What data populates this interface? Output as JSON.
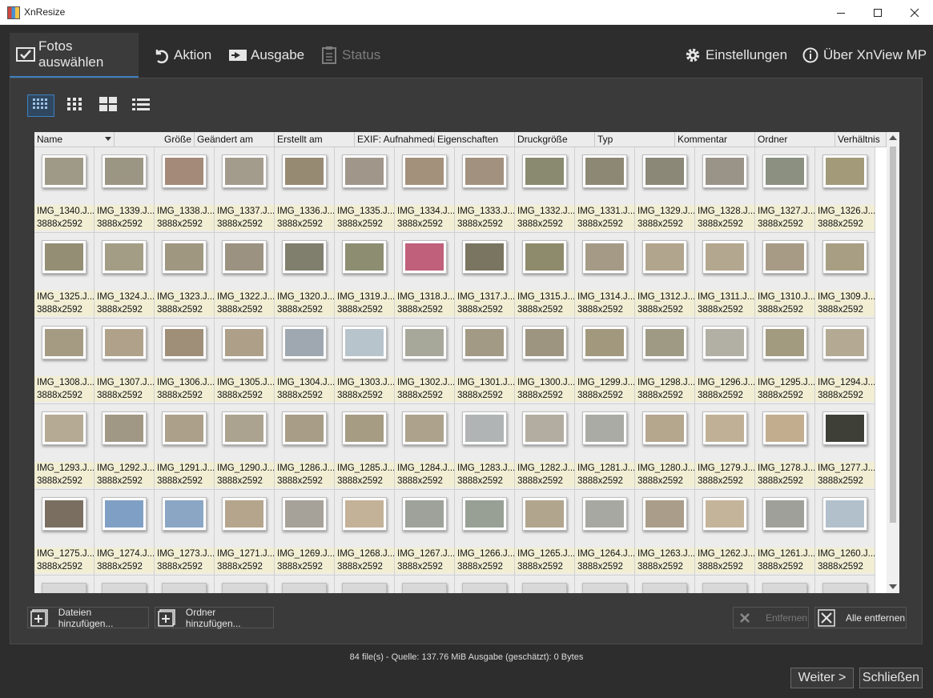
{
  "window": {
    "title": "XnResize"
  },
  "tabs": [
    {
      "label": "Fotos auswählen"
    },
    {
      "label": "Aktion"
    },
    {
      "label": "Ausgabe"
    },
    {
      "label": "Status"
    }
  ],
  "right_tabs": [
    {
      "label": "Einstellungen"
    },
    {
      "label": "Über XnView MP"
    }
  ],
  "columns": [
    "Name",
    "Größe",
    "Geändert am",
    "Erstellt am",
    "EXIF: Aufnahmedatum",
    "Eigenschaften",
    "Druckgröße",
    "Typ",
    "Kommentar",
    "Ordner",
    "Verhältnis"
  ],
  "files": [
    {
      "name": "IMG_1340.J...",
      "dims": "3888x2592",
      "thumb": "#9f9a88"
    },
    {
      "name": "IMG_1339.J...",
      "dims": "3888x2592",
      "thumb": "#9b9583"
    },
    {
      "name": "IMG_1338.J...",
      "dims": "3888x2592",
      "thumb": "#a48a78"
    },
    {
      "name": "IMG_1337.J...",
      "dims": "3888x2592",
      "thumb": "#a39b8c"
    },
    {
      "name": "IMG_1336.J...",
      "dims": "3888x2592",
      "thumb": "#978a73"
    },
    {
      "name": "IMG_1335.J...",
      "dims": "3888x2592",
      "thumb": "#a0968a"
    },
    {
      "name": "IMG_1334.J...",
      "dims": "3888x2592",
      "thumb": "#a4917c"
    },
    {
      "name": "IMG_1333.J...",
      "dims": "3888x2592",
      "thumb": "#a2917f"
    },
    {
      "name": "IMG_1332.J...",
      "dims": "3888x2592",
      "thumb": "#8a8a70"
    },
    {
      "name": "IMG_1331.J...",
      "dims": "3888x2592",
      "thumb": "#8d8873"
    },
    {
      "name": "IMG_1329.J...",
      "dims": "3888x2592",
      "thumb": "#8c8878"
    },
    {
      "name": "IMG_1328.J...",
      "dims": "3888x2592",
      "thumb": "#9a9388"
    },
    {
      "name": "IMG_1327.J...",
      "dims": "3888x2592",
      "thumb": "#8b9081"
    },
    {
      "name": "IMG_1326.J...",
      "dims": "3888x2592",
      "thumb": "#a39a7a"
    },
    {
      "name": "IMG_1325.J...",
      "dims": "3888x2592",
      "thumb": "#948e75"
    },
    {
      "name": "IMG_1324.J...",
      "dims": "3888x2592",
      "thumb": "#a39d85"
    },
    {
      "name": "IMG_1323.J...",
      "dims": "3888x2592",
      "thumb": "#9f9780"
    },
    {
      "name": "IMG_1322.J...",
      "dims": "3888x2592",
      "thumb": "#9b9281"
    },
    {
      "name": "IMG_1320.J...",
      "dims": "3888x2592",
      "thumb": "#807f6e"
    },
    {
      "name": "IMG_1319.J...",
      "dims": "3888x2592",
      "thumb": "#8d8d72"
    },
    {
      "name": "IMG_1318.J...",
      "dims": "3888x2592",
      "thumb": "#c0607a"
    },
    {
      "name": "IMG_1317.J...",
      "dims": "3888x2592",
      "thumb": "#7a7560"
    },
    {
      "name": "IMG_1315.J...",
      "dims": "3888x2592",
      "thumb": "#8e8a6c"
    },
    {
      "name": "IMG_1314.J...",
      "dims": "3888x2592",
      "thumb": "#a49a86"
    },
    {
      "name": "IMG_1312.J...",
      "dims": "3888x2592",
      "thumb": "#b2a58d"
    },
    {
      "name": "IMG_1311.J...",
      "dims": "3888x2592",
      "thumb": "#b4a78f"
    },
    {
      "name": "IMG_1310.J...",
      "dims": "3888x2592",
      "thumb": "#a89b86"
    },
    {
      "name": "IMG_1309.J...",
      "dims": "3888x2592",
      "thumb": "#a89e84"
    },
    {
      "name": "IMG_1308.J...",
      "dims": "3888x2592",
      "thumb": "#a59a82"
    },
    {
      "name": "IMG_1307.J...",
      "dims": "3888x2592",
      "thumb": "#b0a28a"
    },
    {
      "name": "IMG_1306.J...",
      "dims": "3888x2592",
      "thumb": "#9f8f79"
    },
    {
      "name": "IMG_1305.J...",
      "dims": "3888x2592",
      "thumb": "#ad9f88"
    },
    {
      "name": "IMG_1304.J...",
      "dims": "3888x2592",
      "thumb": "#9fa8b0"
    },
    {
      "name": "IMG_1303.J...",
      "dims": "3888x2592",
      "thumb": "#b8c4cc"
    },
    {
      "name": "IMG_1302.J...",
      "dims": "3888x2592",
      "thumb": "#a8a89a"
    },
    {
      "name": "IMG_1301.J...",
      "dims": "3888x2592",
      "thumb": "#a29a85"
    },
    {
      "name": "IMG_1300.J...",
      "dims": "3888x2592",
      "thumb": "#9d9580"
    },
    {
      "name": "IMG_1299.J...",
      "dims": "3888x2592",
      "thumb": "#a2987e"
    },
    {
      "name": "IMG_1298.J...",
      "dims": "3888x2592",
      "thumb": "#9e9a84"
    },
    {
      "name": "IMG_1296.J...",
      "dims": "3888x2592",
      "thumb": "#b2b0a4"
    },
    {
      "name": "IMG_1295.J...",
      "dims": "3888x2592",
      "thumb": "#a29b80"
    },
    {
      "name": "IMG_1294.J...",
      "dims": "3888x2592",
      "thumb": "#b4aa94"
    },
    {
      "name": "IMG_1293.J...",
      "dims": "3888x2592",
      "thumb": "#b5aa93"
    },
    {
      "name": "IMG_1292.J...",
      "dims": "3888x2592",
      "thumb": "#a09784"
    },
    {
      "name": "IMG_1291.J...",
      "dims": "3888x2592",
      "thumb": "#aca08a"
    },
    {
      "name": "IMG_1290.J...",
      "dims": "3888x2592",
      "thumb": "#aba38f"
    },
    {
      "name": "IMG_1286.J...",
      "dims": "3888x2592",
      "thumb": "#a89d86"
    },
    {
      "name": "IMG_1285.J...",
      "dims": "3888x2592",
      "thumb": "#a69c84"
    },
    {
      "name": "IMG_1284.J...",
      "dims": "3888x2592",
      "thumb": "#ada38c"
    },
    {
      "name": "IMG_1283.J...",
      "dims": "3888x2592",
      "thumb": "#b0b4b4"
    },
    {
      "name": "IMG_1282.J...",
      "dims": "3888x2592",
      "thumb": "#b2ada0"
    },
    {
      "name": "IMG_1281.J...",
      "dims": "3888x2592",
      "thumb": "#a9aba4"
    },
    {
      "name": "IMG_1280.J...",
      "dims": "3888x2592",
      "thumb": "#b5a68e"
    },
    {
      "name": "IMG_1279.J...",
      "dims": "3888x2592",
      "thumb": "#c0b196"
    },
    {
      "name": "IMG_1278.J...",
      "dims": "3888x2592",
      "thumb": "#c2ad8e"
    },
    {
      "name": "IMG_1277.J...",
      "dims": "3888x2592",
      "thumb": "#3e4038"
    },
    {
      "name": "IMG_1275.J...",
      "dims": "3888x2592",
      "thumb": "#7a6e60"
    },
    {
      "name": "IMG_1274.J...",
      "dims": "3888x2592",
      "thumb": "#7fa0c4"
    },
    {
      "name": "IMG_1273.J...",
      "dims": "3888x2592",
      "thumb": "#8aa6c4"
    },
    {
      "name": "IMG_1271.J...",
      "dims": "3888x2592",
      "thumb": "#b4a58c"
    },
    {
      "name": "IMG_1269.J...",
      "dims": "3888x2592",
      "thumb": "#a7a299"
    },
    {
      "name": "IMG_1268.J...",
      "dims": "3888x2592",
      "thumb": "#c3b298"
    },
    {
      "name": "IMG_1267.J...",
      "dims": "3888x2592",
      "thumb": "#9ea29a"
    },
    {
      "name": "IMG_1266.J...",
      "dims": "3888x2592",
      "thumb": "#98a095"
    },
    {
      "name": "IMG_1265.J...",
      "dims": "3888x2592",
      "thumb": "#b2a58e"
    },
    {
      "name": "IMG_1264.J...",
      "dims": "3888x2592",
      "thumb": "#a8a8a2"
    },
    {
      "name": "IMG_1263.J...",
      "dims": "3888x2592",
      "thumb": "#aa9e8a"
    },
    {
      "name": "IMG_1262.J...",
      "dims": "3888x2592",
      "thumb": "#c4b49a"
    },
    {
      "name": "IMG_1261.J...",
      "dims": "3888x2592",
      "thumb": "#a0a09a"
    },
    {
      "name": "IMG_1260.J...",
      "dims": "3888x2592",
      "thumb": "#b2c0cc"
    }
  ],
  "buttons": {
    "add_files": "Dateien hinzufügen...",
    "add_folder": "Ordner hinzufügen...",
    "remove": "Entfernen",
    "remove_all": "Alle entfernen"
  },
  "status": "84 file(s) - Quelle: 137.76 MiB Ausgabe (geschätzt): 0 Bytes",
  "footer": {
    "next": "Weiter >",
    "close": "Schließen"
  },
  "colors": {
    "accent": "#3e7fc1",
    "caption_bg": "#f1eed4"
  }
}
